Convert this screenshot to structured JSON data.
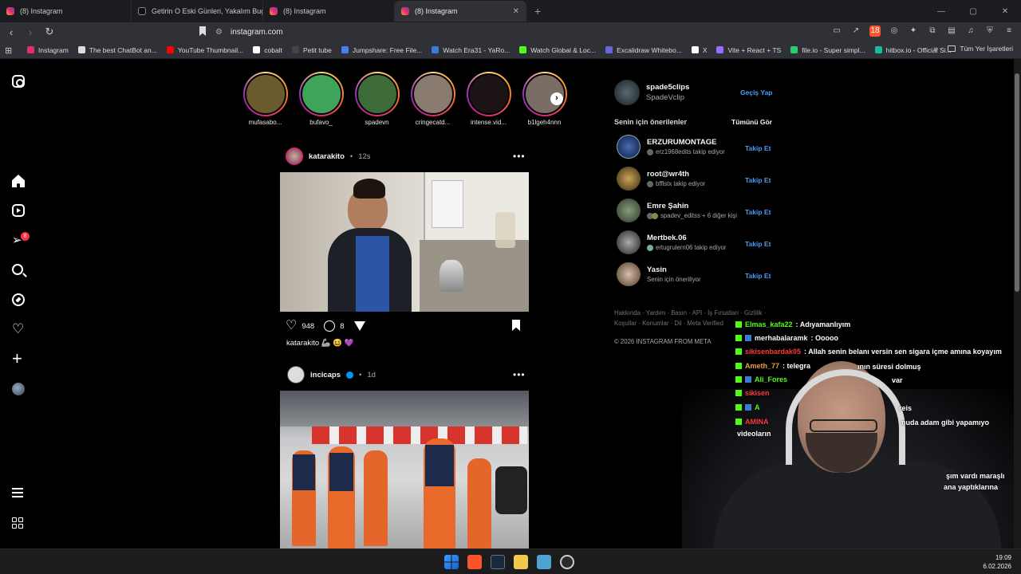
{
  "browser": {
    "tabs": [
      {
        "label": "(8) Instagram",
        "icon": "instagram-icon",
        "active": false
      },
      {
        "label": "Getirin O Eski Günleri, Yakalım Bugün",
        "icon": "tiktok-icon",
        "active": false
      },
      {
        "label": "(8) Instagram",
        "icon": "instagram-icon",
        "active": false
      },
      {
        "label": "(8) Instagram",
        "icon": "instagram-icon",
        "active": true
      }
    ],
    "new_tab": "+",
    "url": "instagram.com",
    "bookmarks": [
      {
        "label": "Instagram",
        "color": "#e1306c"
      },
      {
        "label": "The best ChatBot an...",
        "color": "#ffffff"
      },
      {
        "label": "YouTube Thumbnail...",
        "color": "#ff0000"
      },
      {
        "label": "cobalt",
        "color": "#ffffff"
      },
      {
        "label": "Petit tube",
        "color": "#222222"
      },
      {
        "label": "Jumpshare: Free File...",
        "color": "#4a7df0"
      },
      {
        "label": "Watch Era31 - YaRo...",
        "color": "#3a7bd5"
      },
      {
        "label": "Watch Global & Loc...",
        "color": "#53fc18"
      },
      {
        "label": "Excalidraw Whitebo...",
        "color": "#6965db"
      },
      {
        "label": "X",
        "color": "#ffffff"
      },
      {
        "label": "Vite + React + TS",
        "color": "#9a6cff"
      },
      {
        "label": "file.io - Super simpl...",
        "color": "#2ecc71"
      },
      {
        "label": "hitbox.io - Official Si...",
        "color": "#1abc9c"
      }
    ],
    "bookmarks_more": "»",
    "all_bookmarks": "Tüm Yer İşaretleri",
    "shield_count": "18"
  },
  "instagram": {
    "nav_badge": "8",
    "stories": [
      {
        "name": "mufasabo...",
        "color": "#6b5a2e"
      },
      {
        "name": "bufavo_",
        "color": "#3fa35a"
      },
      {
        "name": "spadevn",
        "color": "#3e6b3a"
      },
      {
        "name": "cringecatd...",
        "color": "#8a7b70"
      },
      {
        "name": "intense.vid...",
        "color": "#1c1414"
      },
      {
        "name": "b1lgeh4nnn",
        "color": "#7a6d65"
      }
    ],
    "posts": [
      {
        "user": "katarakito",
        "sep": "•",
        "ago": "12s",
        "likes": "948",
        "comments": "8",
        "caption": "katarakito 🦾 😆 💜"
      },
      {
        "user": "incicaps",
        "sep": "•",
        "ago": "1d"
      }
    ],
    "me": {
      "username": "spade5clips",
      "display": "SpadeVclip",
      "switch": "Geçiş Yap"
    },
    "suggestions_title": "Senin için önerilenler",
    "see_all": "Tümünü Gör",
    "suggestions": [
      {
        "name": "ERZURUMONTAGE",
        "sub": "erz1968edits takip ediyor",
        "action": "Takip Et",
        "color": "#2a4a8a"
      },
      {
        "name": "root@wr4th",
        "sub": "bfflstx takip ediyor",
        "action": "Takip Et",
        "color": "#6a5a3a"
      },
      {
        "name": "Emre Şahin",
        "sub": "spadev_editss + 6 diğer kişi",
        "action": "Takip Et",
        "color": "#4a5a4a"
      },
      {
        "name": "Mertbek.06",
        "sub": "ertugrulern06 takip ediyor",
        "action": "Takip Et",
        "color": "#555555"
      },
      {
        "name": "Yasin",
        "sub": "Senin için öneriliyor",
        "action": "Takip Et",
        "color": "#8a7a6a"
      }
    ],
    "footer_line1": "Hakkında · Yardım · Basın · API · İş Fırsatları · Gizlilik ·",
    "footer_line2": "Koşullar · Konumlar · Dil · Meta Verified",
    "copyright": "© 2026 INSTAGRAM FROM META"
  },
  "chat": [
    {
      "user": "Elmas_kafa22",
      "color": "#53fc18",
      "msg": ": Adıyamanlıyım"
    },
    {
      "user": "merhabalaramk",
      "color": "#f5f5f5",
      "msg": ": Ooooo"
    },
    {
      "user": "sikisenbardak05",
      "color": "#ff3b3b",
      "msg": ": Allah senin belanı versin sen sigara içme amına koyayım"
    },
    {
      "user": "Ameth_77",
      "color": "#f0a040",
      "msg": ": telegra"
    },
    {
      "user": "Ali_Fores",
      "color": "#53fc18",
      "msg": ""
    },
    {
      "user": "sikisen",
      "color": "#ff3b3b",
      "msg": ""
    },
    {
      "user": "A",
      "color": "#53fc18",
      "msg": ""
    },
    {
      "user": "AMINA",
      "color": "#ff3b3b",
      "msg": ""
    }
  ],
  "chat_fragments": {
    "f1": "ının süresi dolmuş",
    "f2": "var",
    "f3": "reis",
    "f4": "nuda adam gibi yapamıyo",
    "f5": "videoların",
    "f6": "şım vardı maraşlı",
    "f7": "ana yaptıklarına"
  },
  "taskbar": {
    "time": "19:09",
    "date": "6.02.2026"
  }
}
